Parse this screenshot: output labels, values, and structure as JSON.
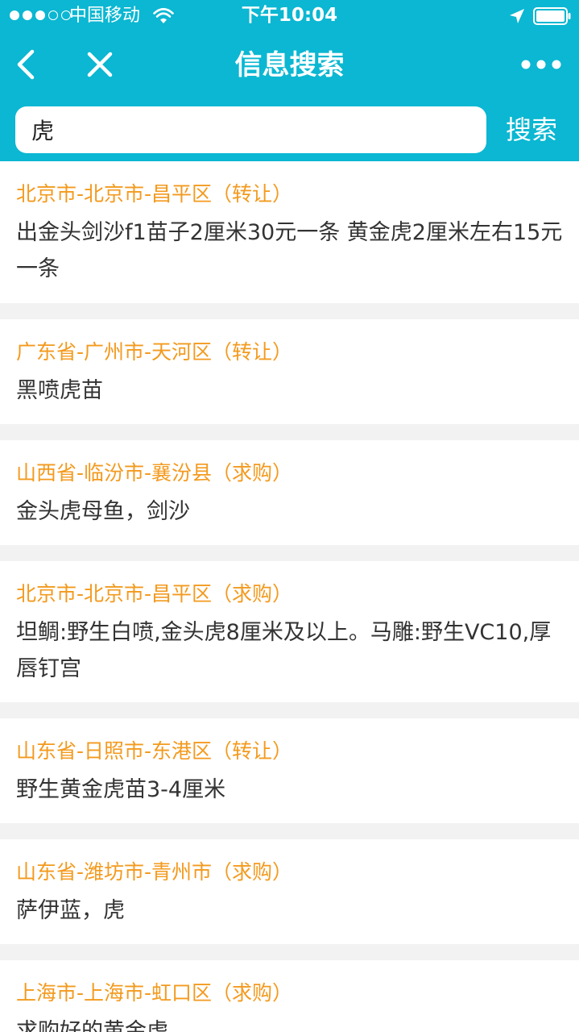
{
  "status_bar": {
    "carrier": "中国移动",
    "time": "下午10:04",
    "signal_dots_filled": 3,
    "signal_dots_total": 5
  },
  "nav": {
    "title": "信息搜索",
    "icons": [
      "chevron-left-icon",
      "close-icon",
      "more-icon"
    ]
  },
  "search": {
    "value": "虎",
    "button_label": "搜索"
  },
  "colors": {
    "header": "#0bb7d2",
    "location_text": "#f39a1e",
    "body_text": "#333333",
    "page_bg": "#f2f2f2"
  },
  "results": [
    {
      "location": "北京市-北京市-昌平区（转让）",
      "description": "出金头剑沙f1苗子2厘米30元一条 黄金虎2厘米左右15元一条"
    },
    {
      "location": "广东省-广州市-天河区（转让）",
      "description": "黑喷虎苗"
    },
    {
      "location": "山西省-临汾市-襄汾县（求购）",
      "description": "金头虎母鱼，剑沙"
    },
    {
      "location": "北京市-北京市-昌平区（求购）",
      "description": "坦鲷:野生白喷,金头虎8厘米及以上。马雕:野生VC10,厚唇钉宫"
    },
    {
      "location": "山东省-日照市-东港区（转让）",
      "description": "野生黄金虎苗3-4厘米"
    },
    {
      "location": "山东省-潍坊市-青州市（求购）",
      "description": "萨伊蓝，虎"
    },
    {
      "location": "上海市-上海市-虹口区（求购）",
      "description": "求购好的黄金虎"
    }
  ]
}
